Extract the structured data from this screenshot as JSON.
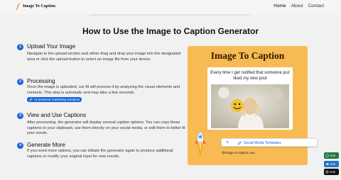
{
  "header": {
    "brand": "Image To Caption",
    "nav": [
      "Home",
      "About",
      "Contact"
    ]
  },
  "main": {
    "title": "How to Use the Image to Caption Generator",
    "steps": [
      {
        "num": "1",
        "title": "Upload Your Image",
        "body": "Navigate to the upload section and either drag and drop your image into the designated area or click the upload button to select an image file from your device."
      },
      {
        "num": "2",
        "title": "Processing",
        "body": "Once the image is uploaded, our AI will process it by analyzing the visual elements and contexts. This step is automatic and may take a few seconds."
      },
      {
        "num": "3",
        "title": "View and Use Captions",
        "body": "After processing, the generator will display several caption options. You can copy these captions to your clipboard, use them directly on your social media, or edit them to better fit your needs."
      },
      {
        "num": "4",
        "title": "Generate More",
        "body": "If you need more options, you can initiate the generator again to produce additional captions or modify your original input for new results."
      }
    ],
    "badge": "AI-powered marketing solutions"
  },
  "card": {
    "title": "Image To Caption",
    "caption": "Every time I get notified that someone just liked my new post",
    "footer": "@image-to-caption.com"
  },
  "popup": {
    "close": "×",
    "link": "Social Media Templates"
  },
  "social": [
    {
      "label": "Join",
      "icon": "whatsapp-icon",
      "color": "#1f7a3f"
    },
    {
      "label": "Join",
      "icon": "telegram-icon",
      "color": "#2476c7"
    },
    {
      "label": "Join",
      "icon": "threads-icon",
      "color": "#111111"
    }
  ],
  "colors": {
    "accent": "#1c63d8",
    "card": "#f8bb53",
    "background": "#f1f1f1"
  }
}
